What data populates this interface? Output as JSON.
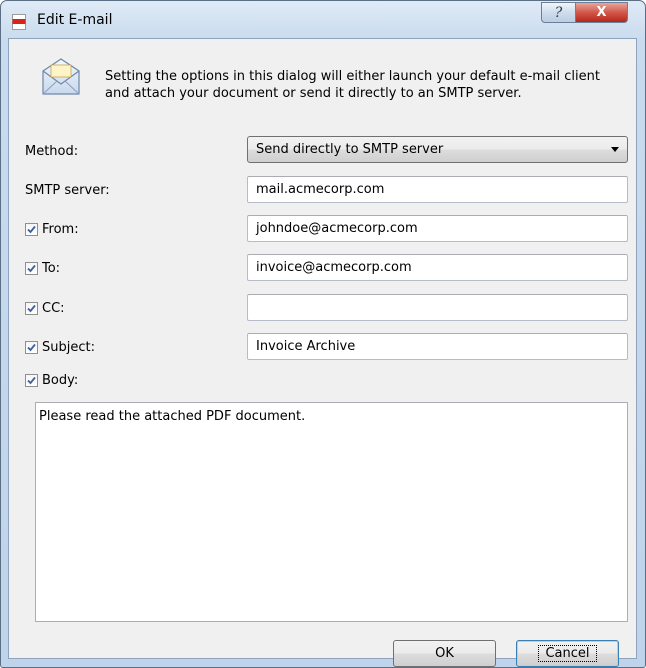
{
  "window": {
    "title": "Edit E-mail",
    "help_label": "?",
    "close_label": "X"
  },
  "intro_text": "Setting the options in this dialog will either launch your default e-mail client and attach your document or send it directly to an SMTP server.",
  "method": {
    "label": "Method:",
    "value": "Send directly to SMTP server"
  },
  "smtp_server": {
    "label": "SMTP server:",
    "value": "mail.acmecorp.com"
  },
  "from": {
    "label": "From:",
    "checked": true,
    "value": "johndoe@acmecorp.com"
  },
  "to": {
    "label": "To:",
    "checked": true,
    "value": "invoice@acmecorp.com"
  },
  "cc": {
    "label": "CC:",
    "checked": true,
    "value": ""
  },
  "subject": {
    "label": "Subject:",
    "checked": true,
    "value": "Invoice Archive"
  },
  "body": {
    "label": "Body:",
    "checked": true,
    "value": "Please read the attached PDF document."
  },
  "buttons": {
    "ok": "OK",
    "cancel": "Cancel"
  },
  "colors": {
    "close_button": "#c9433a",
    "frame": "#c4d6ec",
    "dialog_bg": "#f0f0f0",
    "focus_border": "#3c7fb1"
  }
}
